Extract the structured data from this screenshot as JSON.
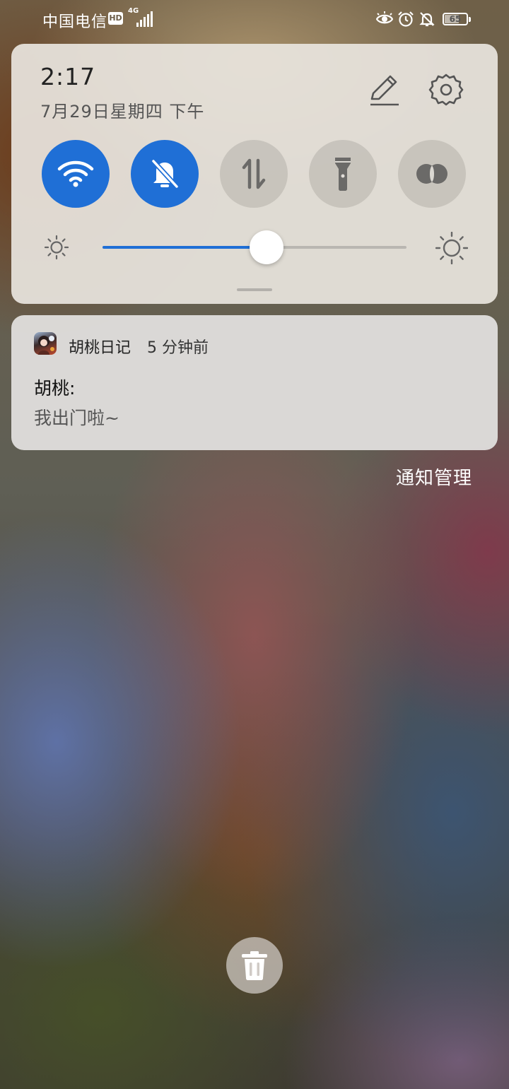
{
  "status_bar": {
    "carrier": "中国电信",
    "hd_badge": "HD",
    "network_type": "4G",
    "battery": "65",
    "icons": [
      "eye-comfort-icon",
      "alarm-clock-icon",
      "bell-off-icon",
      "battery-icon"
    ]
  },
  "quick_settings": {
    "time": "2:17",
    "date": "7月29日星期四 下午",
    "tiles": [
      {
        "name": "wifi",
        "icon": "wifi-icon",
        "active": true
      },
      {
        "name": "silent",
        "icon": "bell-off-icon",
        "active": true
      },
      {
        "name": "mobile-data",
        "icon": "data-arrows-icon",
        "active": false
      },
      {
        "name": "flashlight",
        "icon": "flashlight-icon",
        "active": false
      },
      {
        "name": "color-mode",
        "icon": "overlap-circles-icon",
        "active": false
      }
    ],
    "brightness": 0.54,
    "accent_color": "#1f6fd6"
  },
  "notification": {
    "app_name": "胡桃日记",
    "time": "5 分钟前",
    "title": "胡桃:",
    "body": "我出门啦~"
  },
  "manage_label": "通知管理"
}
